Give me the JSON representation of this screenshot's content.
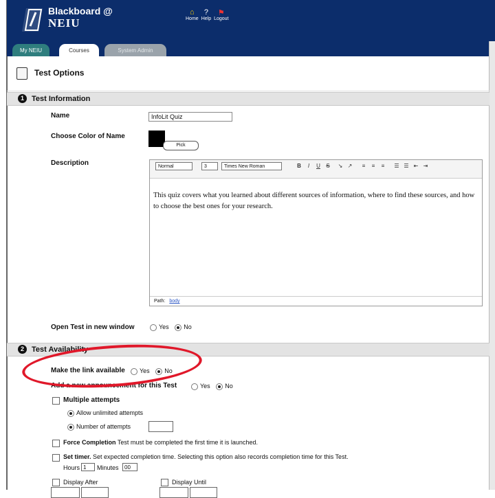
{
  "header": {
    "logo_line1": "Blackboard @",
    "logo_line2": "NEIU",
    "nav": [
      {
        "label": "Home",
        "icon": "home-icon"
      },
      {
        "label": "Help",
        "icon": "help-icon"
      },
      {
        "label": "Logout",
        "icon": "logout-icon"
      }
    ]
  },
  "tabs": [
    {
      "label": "My NEIU",
      "state": "inactive"
    },
    {
      "label": "Courses",
      "state": "active"
    },
    {
      "label": "System Admin",
      "state": "disabled"
    }
  ],
  "page": {
    "title": "Test Options"
  },
  "section1": {
    "number": "1",
    "title": "Test Information",
    "name_label": "Name",
    "name_value": "InfoLit Quiz",
    "color_label": "Choose Color of Name",
    "color_value": "#000000",
    "pick_label": "Pick",
    "description_label": "Description",
    "toolbar": {
      "format": "Normal",
      "size": "3",
      "font": "Times New Roman"
    },
    "description_text": "This quiz covers what you learned about different sources of information, where to find these sources, and how to choose the best ones for your research.",
    "path_label": "Path:",
    "path_value": "body",
    "open_window_label": "Open Test in new window",
    "yes": "Yes",
    "no": "No"
  },
  "section2": {
    "number": "2",
    "title": "Test Availability",
    "make_link_label": "Make the link available",
    "announcement_label": "Add a new announcement for this Test",
    "yes": "Yes",
    "no": "No",
    "multiple_attempts_label": "Multiple attempts",
    "allow_unlimited_label": "Allow unlimited attempts",
    "number_attempts_label": "Number of attempts",
    "force_completion_bold": "Force Completion",
    "force_completion_text": "Test must be completed the first time it is launched.",
    "set_timer_bold": "Set timer.",
    "set_timer_text": "Set expected completion time. Selecting this option also records completion time for this Test.",
    "hours_label": "Hours",
    "hours_value": "1",
    "minutes_label": "Minutes",
    "minutes_value": "00",
    "display_after_label": "Display After",
    "display_until_label": "Display Until"
  },
  "colors": {
    "header": "#0c2d6b",
    "annotation_circle": "#e0182a",
    "section_bar": "#e3e3e3"
  }
}
